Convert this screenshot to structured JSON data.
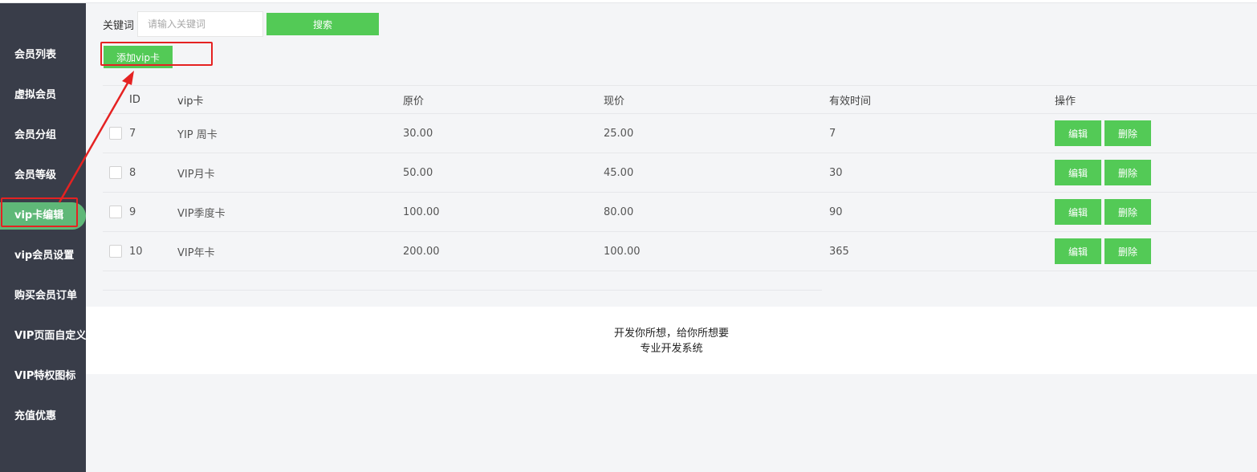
{
  "sidebar": {
    "items": [
      {
        "label": "会员列表"
      },
      {
        "label": "虚拟会员"
      },
      {
        "label": "会员分组"
      },
      {
        "label": "会员等级"
      },
      {
        "label": "vip卡编辑",
        "active": true
      },
      {
        "label": "vip会员设置"
      },
      {
        "label": "购买会员订单"
      },
      {
        "label": "VIP页面自定义"
      },
      {
        "label": "VIP特权图标"
      },
      {
        "label": "充值优惠"
      }
    ]
  },
  "search": {
    "label": "关键词",
    "value": "",
    "placeholder": "请输入关键词",
    "button": "搜索"
  },
  "toolbar": {
    "add_label": "添加vip卡"
  },
  "table": {
    "headers": [
      "ID",
      "vip卡",
      "原价",
      "现价",
      "有效时间",
      "操作"
    ],
    "rows": [
      {
        "id": "7",
        "name": "YIP 周卡",
        "original_price": "30.00",
        "current_price": "25.00",
        "validity": "7",
        "edit": "编辑",
        "delete": "删除"
      },
      {
        "id": "8",
        "name": "VIP月卡",
        "original_price": "50.00",
        "current_price": "45.00",
        "validity": "30",
        "edit": "编辑",
        "delete": "删除"
      },
      {
        "id": "9",
        "name": "VIP季度卡",
        "original_price": "100.00",
        "current_price": "80.00",
        "validity": "90",
        "edit": "编辑",
        "delete": "删除"
      },
      {
        "id": "10",
        "name": "VIP年卡",
        "original_price": "200.00",
        "current_price": "100.00",
        "validity": "365",
        "edit": "编辑",
        "delete": "删除"
      }
    ]
  },
  "footer": {
    "line1": "开发你所想，给你所想要",
    "line2": "专业开发系统"
  },
  "colors": {
    "sidebar_bg": "#393d49",
    "sidebar_active": "#5fb878",
    "button_green": "#53ca56",
    "annotation_red": "#e52222",
    "page_bg": "#f4f5f7"
  }
}
